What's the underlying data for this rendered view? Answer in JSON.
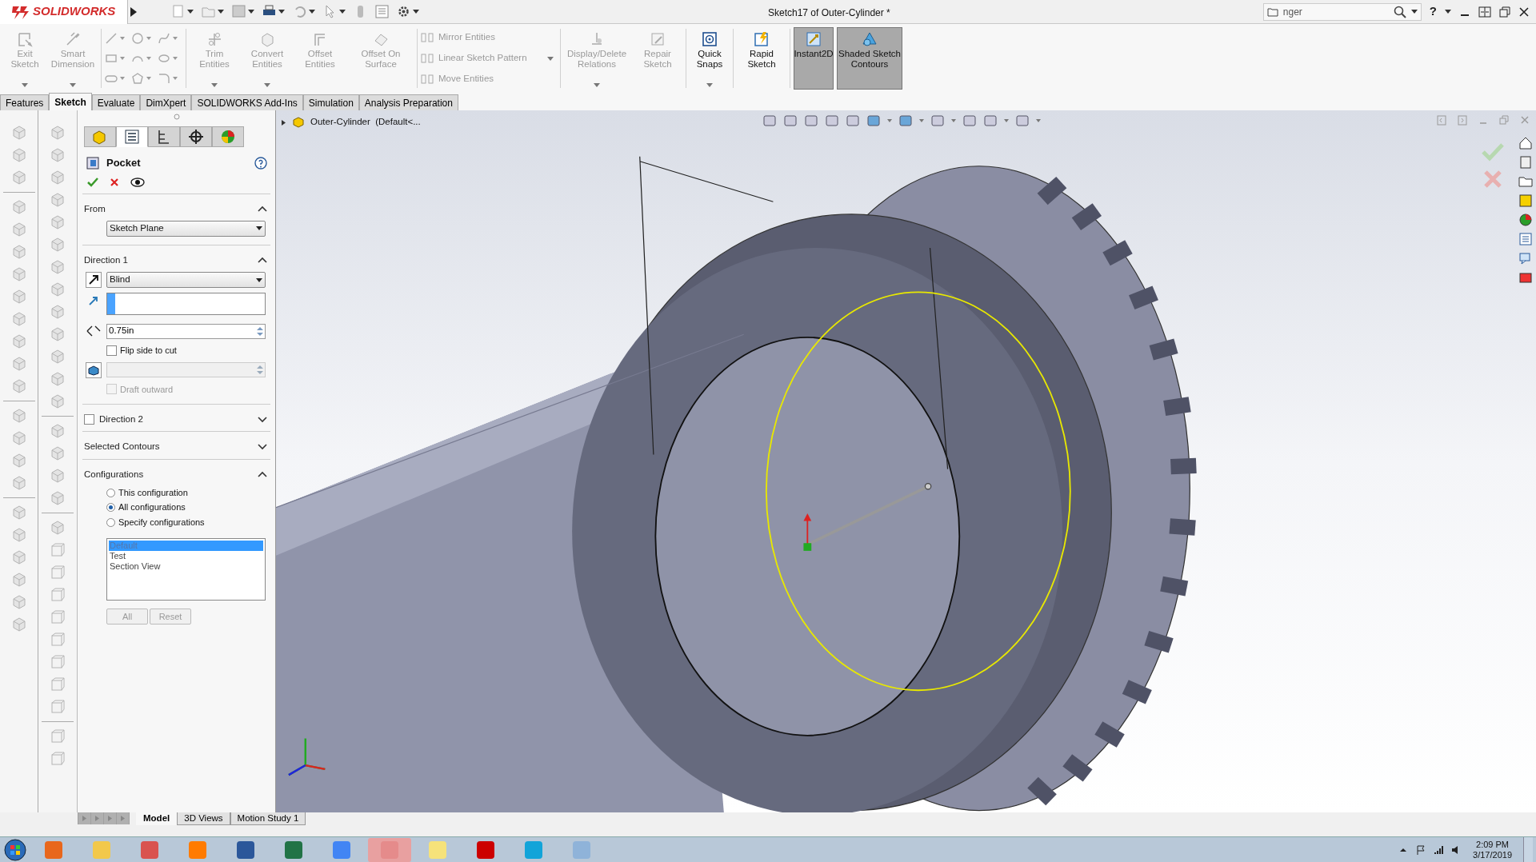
{
  "title_bar": {
    "logo": "SOLIDWORKS",
    "title": "Sketch17 of Outer-Cylinder *",
    "search": {
      "value": "nger"
    },
    "help": "?"
  },
  "command_manager": {
    "tools": [
      {
        "kind": "large",
        "label": "Exit Sketch",
        "disabled": true,
        "pressed": false,
        "dropdown": true
      },
      {
        "kind": "large",
        "label": "Smart Dimension",
        "disabled": true,
        "pressed": false,
        "dropdown": true
      },
      {
        "kind": "grid"
      },
      {
        "kind": "large",
        "label": "Trim Entities",
        "disabled": true,
        "pressed": false,
        "dropdown": true
      },
      {
        "kind": "large",
        "label": "Convert Entities",
        "disabled": true,
        "pressed": false,
        "dropdown": true
      },
      {
        "kind": "large",
        "label": "Offset Entities",
        "disabled": true,
        "pressed": false,
        "dropdown": false
      },
      {
        "kind": "large",
        "label": "Offset On Surface",
        "disabled": true,
        "pressed": false,
        "dropdown": false
      },
      {
        "kind": "stack",
        "items": [
          {
            "label": "Mirror Entities",
            "disabled": true
          },
          {
            "label": "Linear Sketch Pattern",
            "disabled": true
          },
          {
            "label": "Move Entities",
            "disabled": true
          }
        ]
      },
      {
        "kind": "large",
        "label": "Display/Delete Relations",
        "disabled": true,
        "pressed": false,
        "dropdown": true
      },
      {
        "kind": "large",
        "label": "Repair Sketch",
        "disabled": true,
        "pressed": false,
        "dropdown": false
      },
      {
        "kind": "large",
        "label": "Quick Snaps",
        "disabled": false,
        "pressed": false,
        "dropdown": true
      },
      {
        "kind": "large",
        "label": "Rapid Sketch",
        "disabled": false,
        "pressed": false,
        "dropdown": false
      },
      {
        "kind": "large",
        "label": "Instant2D",
        "disabled": false,
        "pressed": true,
        "dropdown": false
      },
      {
        "kind": "large",
        "label": "Shaded Sketch Contours",
        "disabled": false,
        "pressed": true,
        "dropdown": false
      }
    ]
  },
  "tabs": [
    {
      "label": "Features",
      "selected": false
    },
    {
      "label": "Sketch",
      "selected": true
    },
    {
      "label": "Evaluate",
      "selected": false
    },
    {
      "label": "DimXpert",
      "selected": false
    },
    {
      "label": "SOLIDWORKS Add-Ins",
      "selected": false
    },
    {
      "label": "Simulation",
      "selected": false
    },
    {
      "label": "Analysis Preparation",
      "selected": false
    }
  ],
  "property_manager": {
    "panel_tabs": [
      {
        "selected": false
      },
      {
        "selected": true
      },
      {
        "selected": false
      },
      {
        "selected": false
      },
      {
        "selected": false
      }
    ],
    "title": "Pocket",
    "from": {
      "title": "From",
      "expanded": true,
      "value": "Sketch Plane"
    },
    "direction_1": {
      "title": "Direction 1",
      "expanded": true,
      "end_condition": "Blind",
      "depth": "0.75in",
      "flip_side_to_cut": {
        "label": "Flip side to cut",
        "checked": false,
        "disabled": false
      },
      "draft_outward": {
        "label": "Draft outward",
        "checked": false,
        "disabled": true
      }
    },
    "direction_2": {
      "title": "Direction 2",
      "checked": false,
      "expanded": false
    },
    "selected_contours": {
      "title": "Selected Contours",
      "expanded": false
    },
    "configurations": {
      "title": "Configurations",
      "expanded": true,
      "options": [
        {
          "label": "This configuration",
          "selected": false
        },
        {
          "label": "All configurations",
          "selected": true
        },
        {
          "label": "Specify configurations",
          "selected": false
        }
      ],
      "list": [
        {
          "label": "Default",
          "selected": true
        },
        {
          "label": "Test",
          "selected": false
        },
        {
          "label": "Section View",
          "selected": false
        }
      ],
      "buttons": [
        "All",
        "Reset"
      ]
    }
  },
  "viewport": {
    "tree_item": "Outer-Cylinder  (Default<..."
  },
  "bottom_tabs": [
    {
      "label": "Model",
      "selected": true
    },
    {
      "label": "3D Views",
      "selected": false
    },
    {
      "label": "Motion Study 1",
      "selected": false
    }
  ],
  "taskbar": {
    "time": "2:09 PM",
    "date": "3/17/2019"
  }
}
